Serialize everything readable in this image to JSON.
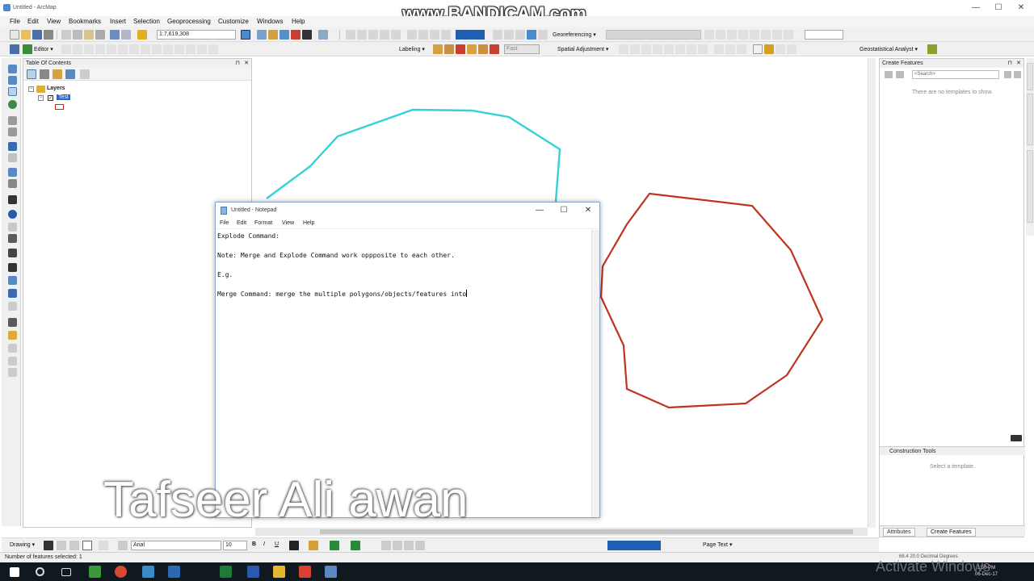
{
  "window": {
    "title": "Untitled - ArcMap",
    "watermark": "www.BANDICAM.com",
    "min": "—",
    "max": "☐",
    "close": "✕"
  },
  "menu": [
    "File",
    "Edit",
    "View",
    "Bookmarks",
    "Insert",
    "Selection",
    "Geoprocessing",
    "Customize",
    "Windows",
    "Help"
  ],
  "toolbar": {
    "scale": "1:7,619,308",
    "georeferencing": "Georeferencing ▾",
    "editor": "Editor ▾",
    "labeling": "Labeling ▾",
    "font_size_box": "Fast",
    "spatial_adjustment": "Spatial Adjustment ▾",
    "geostatistical": "Geostatistical Analyst ▾"
  },
  "toc": {
    "title": "Table Of Contents",
    "pin": "⊓",
    "close": "✕",
    "group": "Layers",
    "layer": "Test"
  },
  "create_features": {
    "title": "Create Features",
    "search_placeholder": "<Search>",
    "empty_msg": "There are no templates to show.",
    "construction_title": "Construction Tools",
    "construction_msg": "Select a template.",
    "tab_attributes": "Attributes",
    "tab_create": "Create Features"
  },
  "notepad": {
    "title": "Untitled - Notepad",
    "menu": [
      "File",
      "Edit",
      "Format",
      "View",
      "Help"
    ],
    "lines": [
      "Explode Command:",
      "",
      "Note: Merge and Explode Command work oppposite to each other.",
      "",
      "E.g.",
      "",
      "Merge Command: merge the multiple polygons/objects/features into"
    ]
  },
  "drawing": {
    "label": "Drawing ▾",
    "font": "Arial",
    "size": "10",
    "page_text": "Page Text ▾"
  },
  "status": {
    "left": "Number of features selected: 1",
    "right": "68.4  20.0 Decimal Degrees"
  },
  "taskbar": {
    "time": "1:50 PM",
    "date": "06-Dec-17"
  },
  "overlay": {
    "author": "Tafseer Ali awan",
    "activate": "Activate Windows"
  },
  "colors": {
    "cyan_polygon": "#34d2d8",
    "red_polygon": "#c0331e",
    "selection_blue": "#2a64c8"
  }
}
